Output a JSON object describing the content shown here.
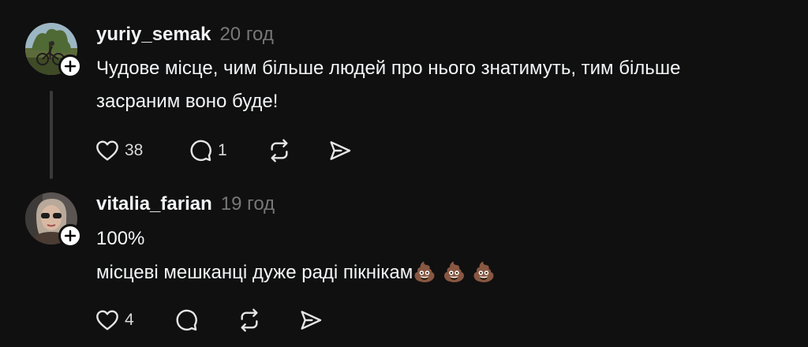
{
  "comments": [
    {
      "username": "yuriy_semak",
      "time": "20 год",
      "text_lines": [
        "Чудове місце, чим більше людей про нього знатимуть, тим більше",
        "засраним воно буде!"
      ],
      "emoji": "",
      "likes": "38",
      "replies": "1",
      "icons": [
        "heart-icon",
        "comment-icon",
        "repost-icon",
        "share-icon",
        "plus-icon"
      ]
    },
    {
      "username": "vitalia_farian",
      "time": "19 год",
      "text_lines": [
        "100%",
        "місцеві мешканці дуже раді пікнікам"
      ],
      "emoji": "💩 💩 💩",
      "likes": "4",
      "replies": "",
      "icons": [
        "heart-icon",
        "comment-icon",
        "repost-icon",
        "share-icon",
        "plus-icon"
      ]
    }
  ],
  "colors": {
    "background": "#101010",
    "text": "#f3f5f7",
    "muted": "#777777",
    "thread_line": "#3a3a3a"
  }
}
